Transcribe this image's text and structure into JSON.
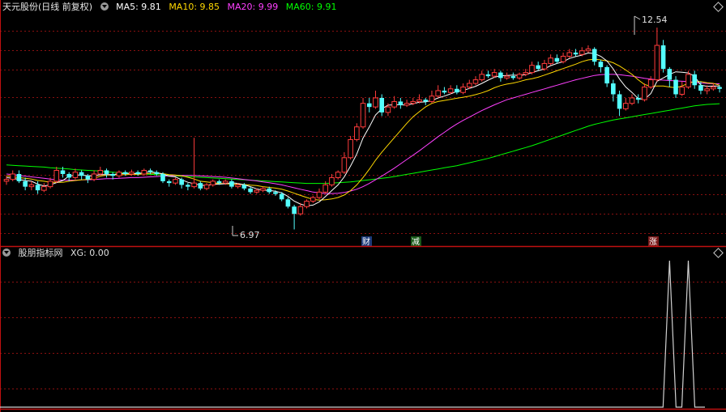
{
  "main_header": {
    "stock_title": "天元股份(日线 前复权)",
    "ma5": "MA5: 9.81",
    "ma10": "MA10: 9.85",
    "ma20": "MA20: 9.99",
    "ma60": "MA60: 9.91"
  },
  "sub_header": {
    "indicator_title": "股朋指标网",
    "xg_value": "XG: 0.00"
  },
  "markers": {
    "high_label": "12.54",
    "low_label": "6.97",
    "event_cai": "财",
    "event_jian": "减",
    "event_zhang": "涨"
  },
  "colors": {
    "background": "#000000",
    "up": "#ff3c3c",
    "down": "#54ffff",
    "ma5": "#ffffff",
    "ma10": "#ffd800",
    "ma20": "#ff40ff",
    "ma60": "#00ff00",
    "grid": "#8a1010",
    "separator": "#c01010",
    "indicator_line": "#d0d0d0"
  },
  "price_range": [
    6.6,
    12.9
  ],
  "candles": [
    [
      8.3,
      8.35,
      8.2,
      8.45
    ],
    [
      8.35,
      8.5,
      8.3,
      8.6
    ],
    [
      8.5,
      8.3,
      8.25,
      8.6
    ],
    [
      8.3,
      8.15,
      8.05,
      8.4
    ],
    [
      8.15,
      8.2,
      8.05,
      8.3
    ],
    [
      8.2,
      8.05,
      7.95,
      8.3
    ],
    [
      8.05,
      8.15,
      8.0,
      8.25
    ],
    [
      8.15,
      8.3,
      8.1,
      8.4
    ],
    [
      8.3,
      8.6,
      8.25,
      8.7
    ],
    [
      8.6,
      8.5,
      8.4,
      8.7
    ],
    [
      8.5,
      8.4,
      8.3,
      8.55
    ],
    [
      8.4,
      8.55,
      8.35,
      8.65
    ],
    [
      8.55,
      8.45,
      8.35,
      8.6
    ],
    [
      8.45,
      8.35,
      8.25,
      8.5
    ],
    [
      8.35,
      8.5,
      8.3,
      8.6
    ],
    [
      8.5,
      8.6,
      8.45,
      8.7
    ],
    [
      8.6,
      8.5,
      8.4,
      8.65
    ],
    [
      8.5,
      8.45,
      8.35,
      8.55
    ],
    [
      8.45,
      8.55,
      8.4,
      8.6
    ],
    [
      8.55,
      8.5,
      8.45,
      8.6
    ],
    [
      8.5,
      8.55,
      8.45,
      8.62
    ],
    [
      8.55,
      8.5,
      8.45,
      8.6
    ],
    [
      8.5,
      8.6,
      8.45,
      8.65
    ],
    [
      8.6,
      8.55,
      8.5,
      8.65
    ],
    [
      8.55,
      8.5,
      8.45,
      8.6
    ],
    [
      8.5,
      8.3,
      8.25,
      8.55
    ],
    [
      8.3,
      8.25,
      8.15,
      8.35
    ],
    [
      8.25,
      8.35,
      8.2,
      8.4
    ],
    [
      8.35,
      8.2,
      8.1,
      8.4
    ],
    [
      8.2,
      8.15,
      8.05,
      8.25
    ],
    [
      8.15,
      8.25,
      8.1,
      9.5
    ],
    [
      8.25,
      8.1,
      8.05,
      8.3
    ],
    [
      8.1,
      8.2,
      8.05,
      8.25
    ],
    [
      8.2,
      8.3,
      8.15,
      8.35
    ],
    [
      8.3,
      8.25,
      8.2,
      8.35
    ],
    [
      8.25,
      8.3,
      8.2,
      8.35
    ],
    [
      8.3,
      8.15,
      8.1,
      8.35
    ],
    [
      8.15,
      8.2,
      8.1,
      8.25
    ],
    [
      8.2,
      8.1,
      8.05,
      8.25
    ],
    [
      8.1,
      8.0,
      7.95,
      8.15
    ],
    [
      8.0,
      8.05,
      7.95,
      8.1
    ],
    [
      8.05,
      8.1,
      8.0,
      8.15
    ],
    [
      8.1,
      8.0,
      7.95,
      8.15
    ],
    [
      8.0,
      7.95,
      7.9,
      8.05
    ],
    [
      7.95,
      7.8,
      7.75,
      8.0
    ],
    [
      7.8,
      7.6,
      7.55,
      7.85
    ],
    [
      7.6,
      7.4,
      6.97,
      7.65
    ],
    [
      7.4,
      7.6,
      7.35,
      7.7
    ],
    [
      7.6,
      7.75,
      7.55,
      7.8
    ],
    [
      7.75,
      7.85,
      7.7,
      7.9
    ],
    [
      7.85,
      8.0,
      7.8,
      8.1
    ],
    [
      8.0,
      8.2,
      7.95,
      8.3
    ],
    [
      8.2,
      8.4,
      8.15,
      8.5
    ],
    [
      8.4,
      8.55,
      8.35,
      8.6
    ],
    [
      8.55,
      8.95,
      8.5,
      9.1
    ],
    [
      8.95,
      9.45,
      8.9,
      9.55
    ],
    [
      9.45,
      9.8,
      9.4,
      9.9
    ],
    [
      9.8,
      10.45,
      9.75,
      10.6
    ],
    [
      10.45,
      10.35,
      10.2,
      10.6
    ],
    [
      10.35,
      10.6,
      10.3,
      10.8
    ],
    [
      10.6,
      10.2,
      10.1,
      10.7
    ],
    [
      10.2,
      10.35,
      10.1,
      10.45
    ],
    [
      10.35,
      10.5,
      10.3,
      10.65
    ],
    [
      10.5,
      10.4,
      10.3,
      10.6
    ],
    [
      10.4,
      10.45,
      10.35,
      10.55
    ],
    [
      10.45,
      10.5,
      10.4,
      10.6
    ],
    [
      10.5,
      10.55,
      10.45,
      10.7
    ],
    [
      10.55,
      10.5,
      10.4,
      10.6
    ],
    [
      10.5,
      10.65,
      10.45,
      10.8
    ],
    [
      10.65,
      10.8,
      10.6,
      10.95
    ],
    [
      10.8,
      10.75,
      10.7,
      10.9
    ],
    [
      10.75,
      10.85,
      10.7,
      10.95
    ],
    [
      10.85,
      10.75,
      10.7,
      10.95
    ],
    [
      10.75,
      10.9,
      10.7,
      11.0
    ],
    [
      10.9,
      11.0,
      10.85,
      11.1
    ],
    [
      11.0,
      11.1,
      10.95,
      11.2
    ],
    [
      11.1,
      11.25,
      11.05,
      11.35
    ],
    [
      11.25,
      11.2,
      11.15,
      11.35
    ],
    [
      11.2,
      11.3,
      11.15,
      11.4
    ],
    [
      11.3,
      11.15,
      11.05,
      11.35
    ],
    [
      11.15,
      11.2,
      11.1,
      11.3
    ],
    [
      11.2,
      11.15,
      11.1,
      11.3
    ],
    [
      11.15,
      11.25,
      11.1,
      11.3
    ],
    [
      11.25,
      11.3,
      11.2,
      11.4
    ],
    [
      11.3,
      11.5,
      11.25,
      11.6
    ],
    [
      11.5,
      11.4,
      11.35,
      11.6
    ],
    [
      11.4,
      11.55,
      11.35,
      11.65
    ],
    [
      11.55,
      11.7,
      11.5,
      11.8
    ],
    [
      11.7,
      11.6,
      11.55,
      11.8
    ],
    [
      11.6,
      11.75,
      11.55,
      11.85
    ],
    [
      11.75,
      11.85,
      11.7,
      11.95
    ],
    [
      11.85,
      11.8,
      11.75,
      11.95
    ],
    [
      11.8,
      11.9,
      11.75,
      12.0
    ],
    [
      11.9,
      11.95,
      11.85,
      12.05
    ],
    [
      11.95,
      11.6,
      11.5,
      12.0
    ],
    [
      11.6,
      11.45,
      11.3,
      11.65
    ],
    [
      11.45,
      11.0,
      10.9,
      11.5
    ],
    [
      11.0,
      10.7,
      10.5,
      11.1
    ],
    [
      10.7,
      10.3,
      10.1,
      10.8
    ],
    [
      10.3,
      10.45,
      10.25,
      10.6
    ],
    [
      10.45,
      10.6,
      10.4,
      10.7
    ],
    [
      10.6,
      10.55,
      10.45,
      10.7
    ],
    [
      10.55,
      10.9,
      10.5,
      11.0
    ],
    [
      10.9,
      11.1,
      10.85,
      11.2
    ],
    [
      11.1,
      12.05,
      11.05,
      12.54
    ],
    [
      12.05,
      11.4,
      11.3,
      12.2
    ],
    [
      11.4,
      11.1,
      10.9,
      11.45
    ],
    [
      11.1,
      10.7,
      10.6,
      11.2
    ],
    [
      10.7,
      10.9,
      10.65,
      11.05
    ],
    [
      10.9,
      11.25,
      10.85,
      11.35
    ],
    [
      11.25,
      10.95,
      10.85,
      11.35
    ],
    [
      10.95,
      10.8,
      10.7,
      11.05
    ],
    [
      10.8,
      10.85,
      10.7,
      10.95
    ],
    [
      10.85,
      10.9,
      10.8,
      11.0
    ],
    [
      10.9,
      10.85,
      10.75,
      10.95
    ]
  ],
  "ma5_values": [
    8.4,
    8.38,
    8.35,
    8.32,
    8.3,
    8.22,
    8.17,
    8.2,
    8.26,
    8.32,
    8.44,
    8.47,
    8.47,
    8.45,
    8.45,
    8.48,
    8.48,
    8.48,
    8.51,
    8.52,
    8.51,
    8.51,
    8.54,
    8.56,
    8.54,
    8.5,
    8.44,
    8.42,
    8.34,
    8.27,
    8.23,
    8.19,
    8.18,
    8.22,
    8.22,
    8.23,
    8.26,
    8.24,
    8.2,
    8.15,
    8.09,
    8.05,
    8.05,
    8.02,
    7.98,
    7.88,
    7.75,
    7.67,
    7.62,
    7.64,
    7.73,
    7.88,
    8.04,
    8.2,
    8.42,
    8.72,
    9.05,
    9.49,
    9.8,
    10.13,
    10.3,
    10.4,
    10.41,
    10.41,
    10.4,
    10.44,
    10.48,
    10.49,
    10.53,
    10.6,
    10.65,
    10.71,
    10.78,
    10.81,
    10.86,
    10.92,
    11.0,
    11.09,
    11.17,
    11.21,
    11.22,
    11.23,
    11.22,
    11.24,
    11.3,
    11.35,
    11.4,
    11.49,
    11.55,
    11.6,
    11.69,
    11.74,
    11.78,
    11.84,
    11.82,
    11.75,
    11.62,
    11.4,
    11.12,
    10.9,
    10.75,
    10.58,
    10.56,
    10.72,
    11.06,
    11.15,
    11.25,
    11.32,
    11.31,
    11.29,
    11.2,
    10.95,
    10.92,
    10.93,
    10.93
  ],
  "ma10_values": [
    8.45,
    8.42,
    8.4,
    8.38,
    8.36,
    8.32,
    8.3,
    8.27,
    8.27,
    8.27,
    8.3,
    8.32,
    8.34,
    8.35,
    8.38,
    8.44,
    8.47,
    8.47,
    8.48,
    8.48,
    8.49,
    8.49,
    8.5,
    8.52,
    8.52,
    8.51,
    8.48,
    8.47,
    8.45,
    8.41,
    8.36,
    8.3,
    8.28,
    8.26,
    8.24,
    8.23,
    8.22,
    8.21,
    8.21,
    8.19,
    8.18,
    8.15,
    8.13,
    8.11,
    8.08,
    8.03,
    7.97,
    7.91,
    7.85,
    7.8,
    7.78,
    7.79,
    7.81,
    7.85,
    7.92,
    8.04,
    8.2,
    8.4,
    8.63,
    8.88,
    9.1,
    9.3,
    9.5,
    9.7,
    9.9,
    10.08,
    10.22,
    10.35,
    10.45,
    10.5,
    10.53,
    10.56,
    10.59,
    10.62,
    10.65,
    10.69,
    10.74,
    10.8,
    10.88,
    10.94,
    10.98,
    11.01,
    11.05,
    11.1,
    11.13,
    11.17,
    11.23,
    11.29,
    11.35,
    11.41,
    11.47,
    11.53,
    11.6,
    11.65,
    11.67,
    11.65,
    11.62,
    11.57,
    11.48,
    11.37,
    11.25,
    11.1,
    10.97,
    10.92,
    10.93,
    10.93,
    10.9,
    10.88,
    10.93,
    11.0,
    11.05,
    11.05,
    11.02,
    11.0,
    10.95
  ],
  "ma20_values": [
    8.5,
    8.48,
    8.46,
    8.44,
    8.42,
    8.4,
    8.38,
    8.36,
    8.34,
    8.33,
    8.33,
    8.33,
    8.34,
    8.34,
    8.35,
    8.36,
    8.37,
    8.37,
    8.38,
    8.39,
    8.4,
    8.4,
    8.41,
    8.42,
    8.43,
    8.44,
    8.45,
    8.46,
    8.46,
    8.46,
    8.46,
    8.45,
    8.44,
    8.43,
    8.42,
    8.41,
    8.39,
    8.37,
    8.35,
    8.33,
    8.31,
    8.28,
    8.26,
    8.23,
    8.2,
    8.16,
    8.12,
    8.08,
    8.04,
    8.0,
    7.98,
    7.96,
    7.96,
    7.97,
    7.99,
    8.03,
    8.08,
    8.15,
    8.24,
    8.34,
    8.44,
    8.55,
    8.66,
    8.78,
    8.9,
    9.02,
    9.14,
    9.27,
    9.4,
    9.53,
    9.65,
    9.77,
    9.88,
    9.98,
    10.07,
    10.16,
    10.25,
    10.33,
    10.41,
    10.48,
    10.55,
    10.6,
    10.65,
    10.7,
    10.75,
    10.8,
    10.85,
    10.9,
    10.95,
    11.0,
    11.05,
    11.1,
    11.14,
    11.18,
    11.22,
    11.24,
    11.25,
    11.25,
    11.24,
    11.22,
    11.2,
    11.17,
    11.14,
    11.12,
    11.1,
    11.09,
    11.08,
    11.07,
    11.06,
    11.05,
    11.03,
    11.01,
    11.0,
    10.99,
    10.99
  ],
  "ma60_values": [
    8.75,
    8.74,
    8.73,
    8.72,
    8.71,
    8.7,
    8.69,
    8.67,
    8.66,
    8.65,
    8.64,
    8.62,
    8.61,
    8.6,
    8.59,
    8.58,
    8.56,
    8.55,
    8.54,
    8.53,
    8.52,
    8.51,
    8.5,
    8.49,
    8.48,
    8.47,
    8.46,
    8.45,
    8.44,
    8.43,
    8.42,
    8.41,
    8.4,
    8.39,
    8.38,
    8.37,
    8.36,
    8.35,
    8.34,
    8.33,
    8.32,
    8.31,
    8.3,
    8.29,
    8.28,
    8.27,
    8.26,
    8.25,
    8.24,
    8.24,
    8.24,
    8.24,
    8.25,
    8.26,
    8.27,
    8.28,
    8.3,
    8.32,
    8.34,
    8.36,
    8.38,
    8.4,
    8.43,
    8.46,
    8.49,
    8.52,
    8.55,
    8.58,
    8.61,
    8.64,
    8.67,
    8.7,
    8.73,
    8.77,
    8.81,
    8.85,
    8.89,
    8.93,
    8.98,
    9.03,
    9.08,
    9.13,
    9.18,
    9.23,
    9.28,
    9.34,
    9.4,
    9.46,
    9.52,
    9.58,
    9.64,
    9.7,
    9.76,
    9.82,
    9.87,
    9.91,
    9.95,
    9.99,
    10.02,
    10.05,
    10.08,
    10.11,
    10.14,
    10.17,
    10.2,
    10.23,
    10.26,
    10.29,
    10.32,
    10.35,
    10.38,
    10.4,
    10.42,
    10.43,
    10.44
  ],
  "xg_signal_indices": [
    106,
    109
  ]
}
